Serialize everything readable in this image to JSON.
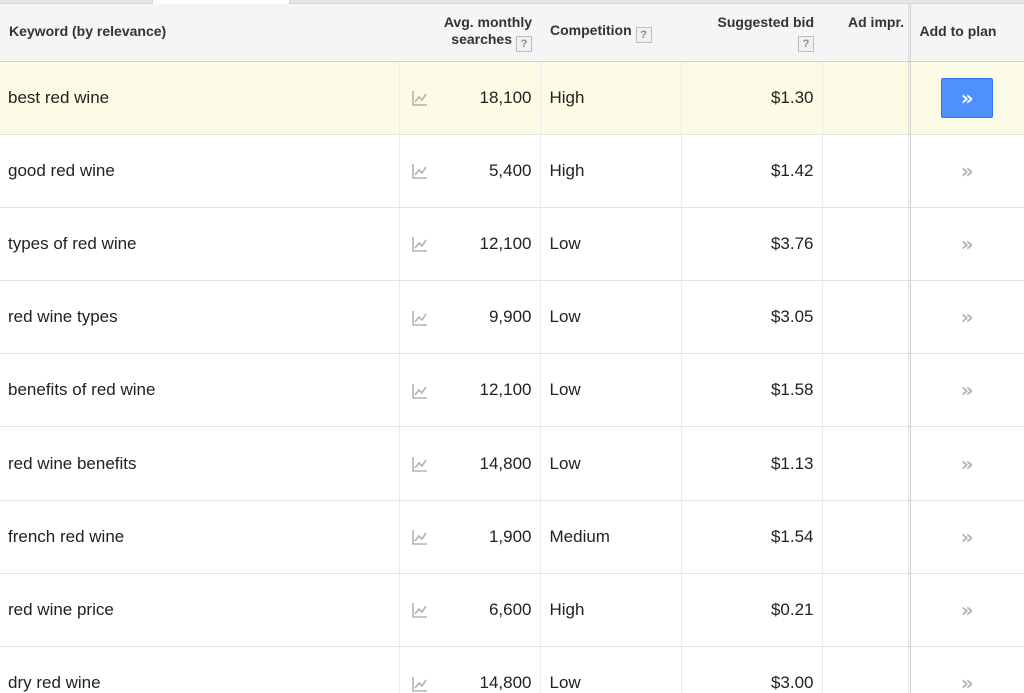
{
  "header": {
    "keyword": "Keyword (by relevance)",
    "searches_line1": "Avg. monthly",
    "searches_line2": "searches",
    "competition": "Competition",
    "suggested_bid": "Suggested bid",
    "ad_impr": "Ad impr.",
    "add_to_plan": "Add to plan",
    "help_glyph": "?"
  },
  "add_glyph": "»",
  "rows": [
    {
      "keyword": "best red wine",
      "searches": "18,100",
      "competition": "High",
      "bid": "$1.30"
    },
    {
      "keyword": "good red wine",
      "searches": "5,400",
      "competition": "High",
      "bid": "$1.42"
    },
    {
      "keyword": "types of red wine",
      "searches": "12,100",
      "competition": "Low",
      "bid": "$3.76"
    },
    {
      "keyword": "red wine types",
      "searches": "9,900",
      "competition": "Low",
      "bid": "$3.05"
    },
    {
      "keyword": "benefits of red wine",
      "searches": "12,100",
      "competition": "Low",
      "bid": "$1.58"
    },
    {
      "keyword": "red wine benefits",
      "searches": "14,800",
      "competition": "Low",
      "bid": "$1.13"
    },
    {
      "keyword": "french red wine",
      "searches": "1,900",
      "competition": "Medium",
      "bid": "$1.54"
    },
    {
      "keyword": "red wine price",
      "searches": "6,600",
      "competition": "High",
      "bid": "$0.21"
    },
    {
      "keyword": "dry red wine",
      "searches": "14,800",
      "competition": "Low",
      "bid": "$3.00"
    }
  ],
  "colors": {
    "selected_row": "#fbfbe6",
    "primary_button": "#4d90fe",
    "header_bg": "#f5f5f5"
  }
}
